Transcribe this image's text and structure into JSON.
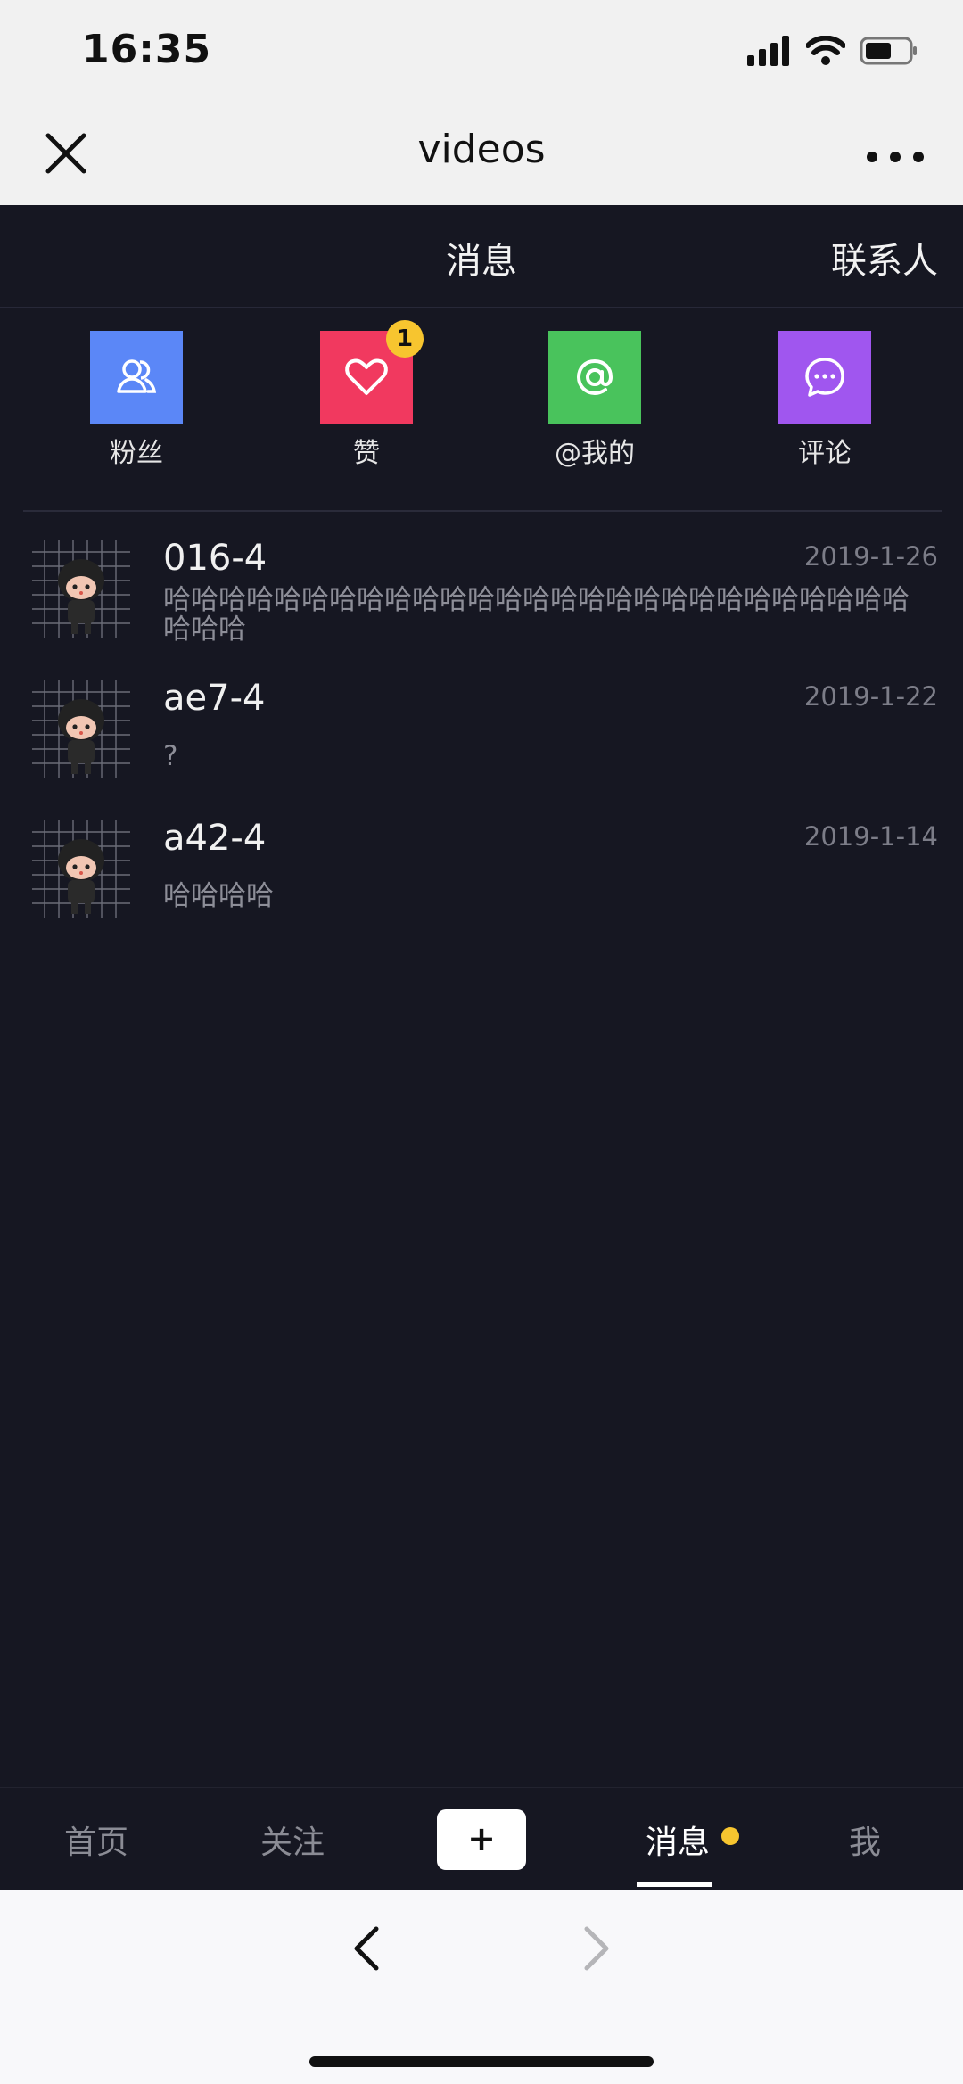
{
  "status": {
    "time": "16:35"
  },
  "browser": {
    "title": "videos"
  },
  "header": {
    "title": "消息",
    "contacts": "联系人"
  },
  "categories": [
    {
      "label": "粉丝",
      "icon": "fans-icon",
      "color": "#5b87f7"
    },
    {
      "label": "赞",
      "icon": "heart-icon",
      "color": "#f1395f",
      "badge": "1"
    },
    {
      "label": "@我的",
      "icon": "at-icon",
      "color": "#49c35c"
    },
    {
      "label": "评论",
      "icon": "comment-icon",
      "color": "#a056ef"
    }
  ],
  "messages": [
    {
      "name": "016-4",
      "date": "2019-1-26",
      "text": "哈哈哈哈哈哈哈哈哈哈哈哈哈哈哈哈哈哈哈哈哈哈哈哈哈哈哈哈哈哈"
    },
    {
      "name": "ae7-4",
      "date": "2019-1-22",
      "text": "?"
    },
    {
      "name": "a42-4",
      "date": "2019-1-14",
      "text": "哈哈哈哈"
    }
  ],
  "tabs": {
    "home": "首页",
    "follow": "关注",
    "plus": "+",
    "messages": "消息",
    "me": "我"
  },
  "colors": {
    "background": "#161722",
    "badge": "#f7c52f"
  }
}
